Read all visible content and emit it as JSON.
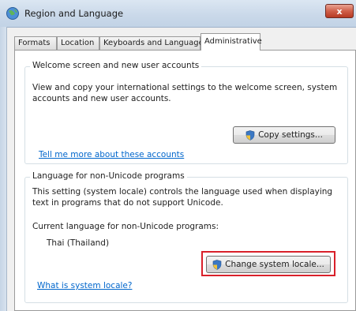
{
  "window": {
    "title": "Region and Language",
    "close_label": "x"
  },
  "tabs": [
    {
      "label": "Formats"
    },
    {
      "label": "Location"
    },
    {
      "label": "Keyboards and Languages"
    },
    {
      "label": "Administrative"
    }
  ],
  "welcome_group": {
    "legend": "Welcome screen and new user accounts",
    "description_line1": "View and copy your international settings to the welcome screen, system",
    "description_line2": "accounts and new user accounts.",
    "copy_button": "Copy settings...",
    "link": "Tell me more about these accounts"
  },
  "non_unicode_group": {
    "legend": "Language for non-Unicode programs",
    "description_line1": "This setting (system locale) controls the language used when displaying",
    "description_line2": "text in programs that do not support Unicode.",
    "current_label": "Current language for non-Unicode programs:",
    "current_value": "Thai (Thailand)",
    "change_button": "Change system locale...",
    "link": "What is system locale?"
  },
  "colors": {
    "highlight": "#d9202a",
    "link": "#0066cc",
    "close": "#c84a33"
  },
  "icons": {
    "app": "globe-icon",
    "uac": "shield-icon"
  }
}
